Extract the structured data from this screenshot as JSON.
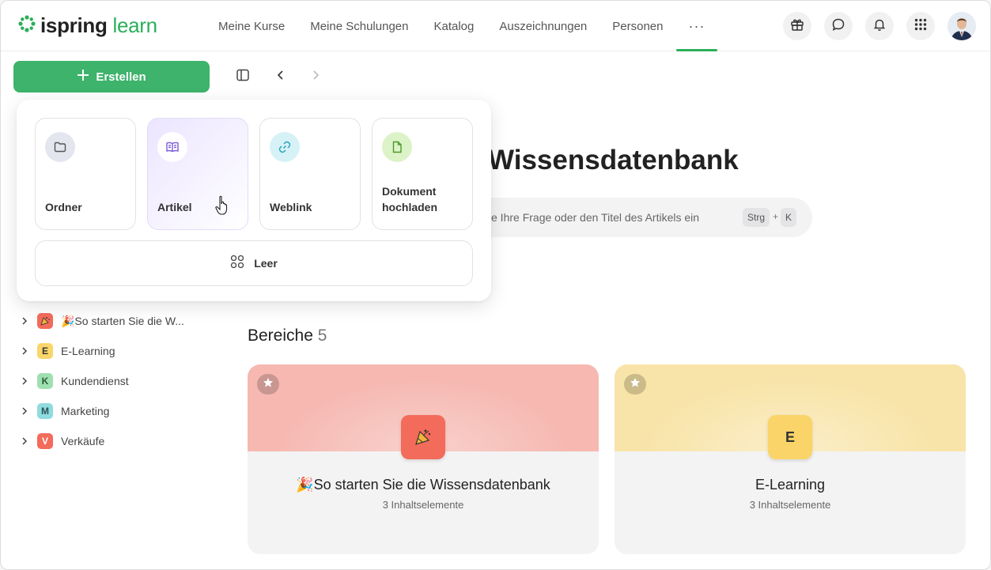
{
  "app": {
    "logo_part1": "ispring",
    "logo_part2": "learn",
    "brand_color": "#2cae5b"
  },
  "nav": {
    "items": [
      "Meine Kurse",
      "Meine Schulungen",
      "Katalog",
      "Auszeichnungen",
      "Personen"
    ],
    "more": "···"
  },
  "toolbar": {
    "create_label": "Erstellen"
  },
  "page": {
    "title": "Wissensdatenbank",
    "search_placeholder": "e Ihre Frage oder den Titel des Artikels ein",
    "shortcut_key1": "Strg",
    "shortcut_plus": "+",
    "shortcut_key2": "K"
  },
  "create_menu": {
    "options": [
      {
        "label": "Ordner",
        "icon": "folder-icon"
      },
      {
        "label": "Artikel",
        "icon": "book-icon"
      },
      {
        "label": "Weblink",
        "icon": "link-icon"
      },
      {
        "label_line1": "Dokument",
        "label_line2": "hochladen",
        "icon": "document-icon"
      }
    ],
    "empty_label": "Leer"
  },
  "sidebar": {
    "items": [
      {
        "badge": "",
        "label": "🎉So starten Sie die W...",
        "color": "#f36b5b"
      },
      {
        "badge": "E",
        "label": "E-Learning",
        "color": "#f9d66a"
      },
      {
        "badge": "K",
        "label": "Kundendienst",
        "color": "#9ee0b0"
      },
      {
        "badge": "M",
        "label": "Marketing",
        "color": "#8fdbe0"
      },
      {
        "badge": "V",
        "label": "Verkäufe",
        "color": "#f36b5b"
      }
    ]
  },
  "sections": {
    "title": "Bereiche",
    "count": "5",
    "cards": [
      {
        "icon_text": "🎉",
        "title": "🎉So starten Sie die Wissensdatenbank",
        "subtitle": "3 Inhaltselemente",
        "color": "#f6b8b1"
      },
      {
        "icon_text": "E",
        "title": "E-Learning",
        "subtitle": "3 Inhaltselemente",
        "color": "#f8e4a8"
      }
    ]
  }
}
